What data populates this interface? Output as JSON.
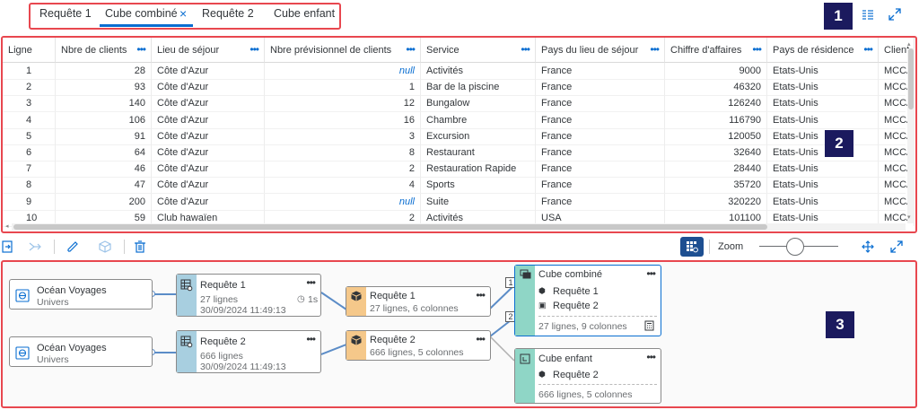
{
  "tabs": [
    {
      "label": "Requête 1"
    },
    {
      "label": "Cube combiné",
      "active": true
    },
    {
      "label": "Requête 2"
    },
    {
      "label": "Cube enfant"
    }
  ],
  "tab_close": "×",
  "badges": {
    "one": "1",
    "two": "2",
    "three": "3"
  },
  "table": {
    "columns": [
      "Ligne",
      "Nbre de clients",
      "Lieu de séjour",
      "Nbre prévisionnel de clients",
      "Service",
      "Pays du lieu de séjour",
      "Chiffre d'affaires",
      "Pays de résidence",
      "Client"
    ],
    "rows": [
      [
        "1",
        "28",
        "Côte d'Azur",
        "null",
        "Activités",
        "France",
        "9000",
        "Etats-Unis",
        "MCCA"
      ],
      [
        "2",
        "93",
        "Côte d'Azur",
        "1",
        "Bar de la piscine",
        "France",
        "46320",
        "Etats-Unis",
        "MCCA"
      ],
      [
        "3",
        "140",
        "Côte d'Azur",
        "12",
        "Bungalow",
        "France",
        "126240",
        "Etats-Unis",
        "MCCA"
      ],
      [
        "4",
        "106",
        "Côte d'Azur",
        "16",
        "Chambre",
        "France",
        "116790",
        "Etats-Unis",
        "MCCA"
      ],
      [
        "5",
        "91",
        "Côte d'Azur",
        "3",
        "Excursion",
        "France",
        "120050",
        "Etats-Unis",
        "MCCA"
      ],
      [
        "6",
        "64",
        "Côte d'Azur",
        "8",
        "Restaurant",
        "France",
        "32640",
        "Etats-Unis",
        "MCCA"
      ],
      [
        "7",
        "46",
        "Côte d'Azur",
        "2",
        "Restauration Rapide",
        "France",
        "28440",
        "Etats-Unis",
        "MCCA"
      ],
      [
        "8",
        "47",
        "Côte d'Azur",
        "4",
        "Sports",
        "France",
        "35720",
        "Etats-Unis",
        "MCCA"
      ],
      [
        "9",
        "200",
        "Côte d'Azur",
        "null",
        "Suite",
        "France",
        "320220",
        "Etats-Unis",
        "MCCA"
      ],
      [
        "10",
        "59",
        "Club hawaïen",
        "2",
        "Activités",
        "USA",
        "101100",
        "Etats-Unis",
        "MCCA"
      ]
    ]
  },
  "toolbar": {
    "zoom_label": "Zoom",
    "zoom_level": 0.45
  },
  "diagram": {
    "sources": [
      {
        "title": "Océan Voyages",
        "sub": "Univers"
      },
      {
        "title": "Océan Voyages",
        "sub": "Univers"
      }
    ],
    "queries": [
      {
        "title": "Requête 1",
        "lines": "27 lignes",
        "date": "30/09/2024 11:49:13",
        "time": "1s"
      },
      {
        "title": "Requête 2",
        "lines": "666 lignes",
        "date": "30/09/2024 11:49:13"
      }
    ],
    "cubes": [
      {
        "title": "Requête 1",
        "sub": "27 lignes, 6 colonnes"
      },
      {
        "title": "Requête 2",
        "sub": "666 lignes, 5 colonnes"
      }
    ],
    "combined": {
      "title": "Cube combiné",
      "items": [
        "Requête 1",
        "Requête 2"
      ],
      "footer": "27 lignes, 9 colonnes"
    },
    "child": {
      "title": "Cube enfant",
      "items": [
        "Requête 2"
      ],
      "footer": "666 lignes, 5 colonnes"
    },
    "pins": [
      "1",
      "2"
    ]
  },
  "colors": {
    "accent": "#0a6ed1",
    "highlight": "#e8474f",
    "badge": "#1b1a5e",
    "query_strip": "#a8cfe0",
    "cube_strip": "#f5c88a",
    "result_strip": "#8fd6c6"
  }
}
